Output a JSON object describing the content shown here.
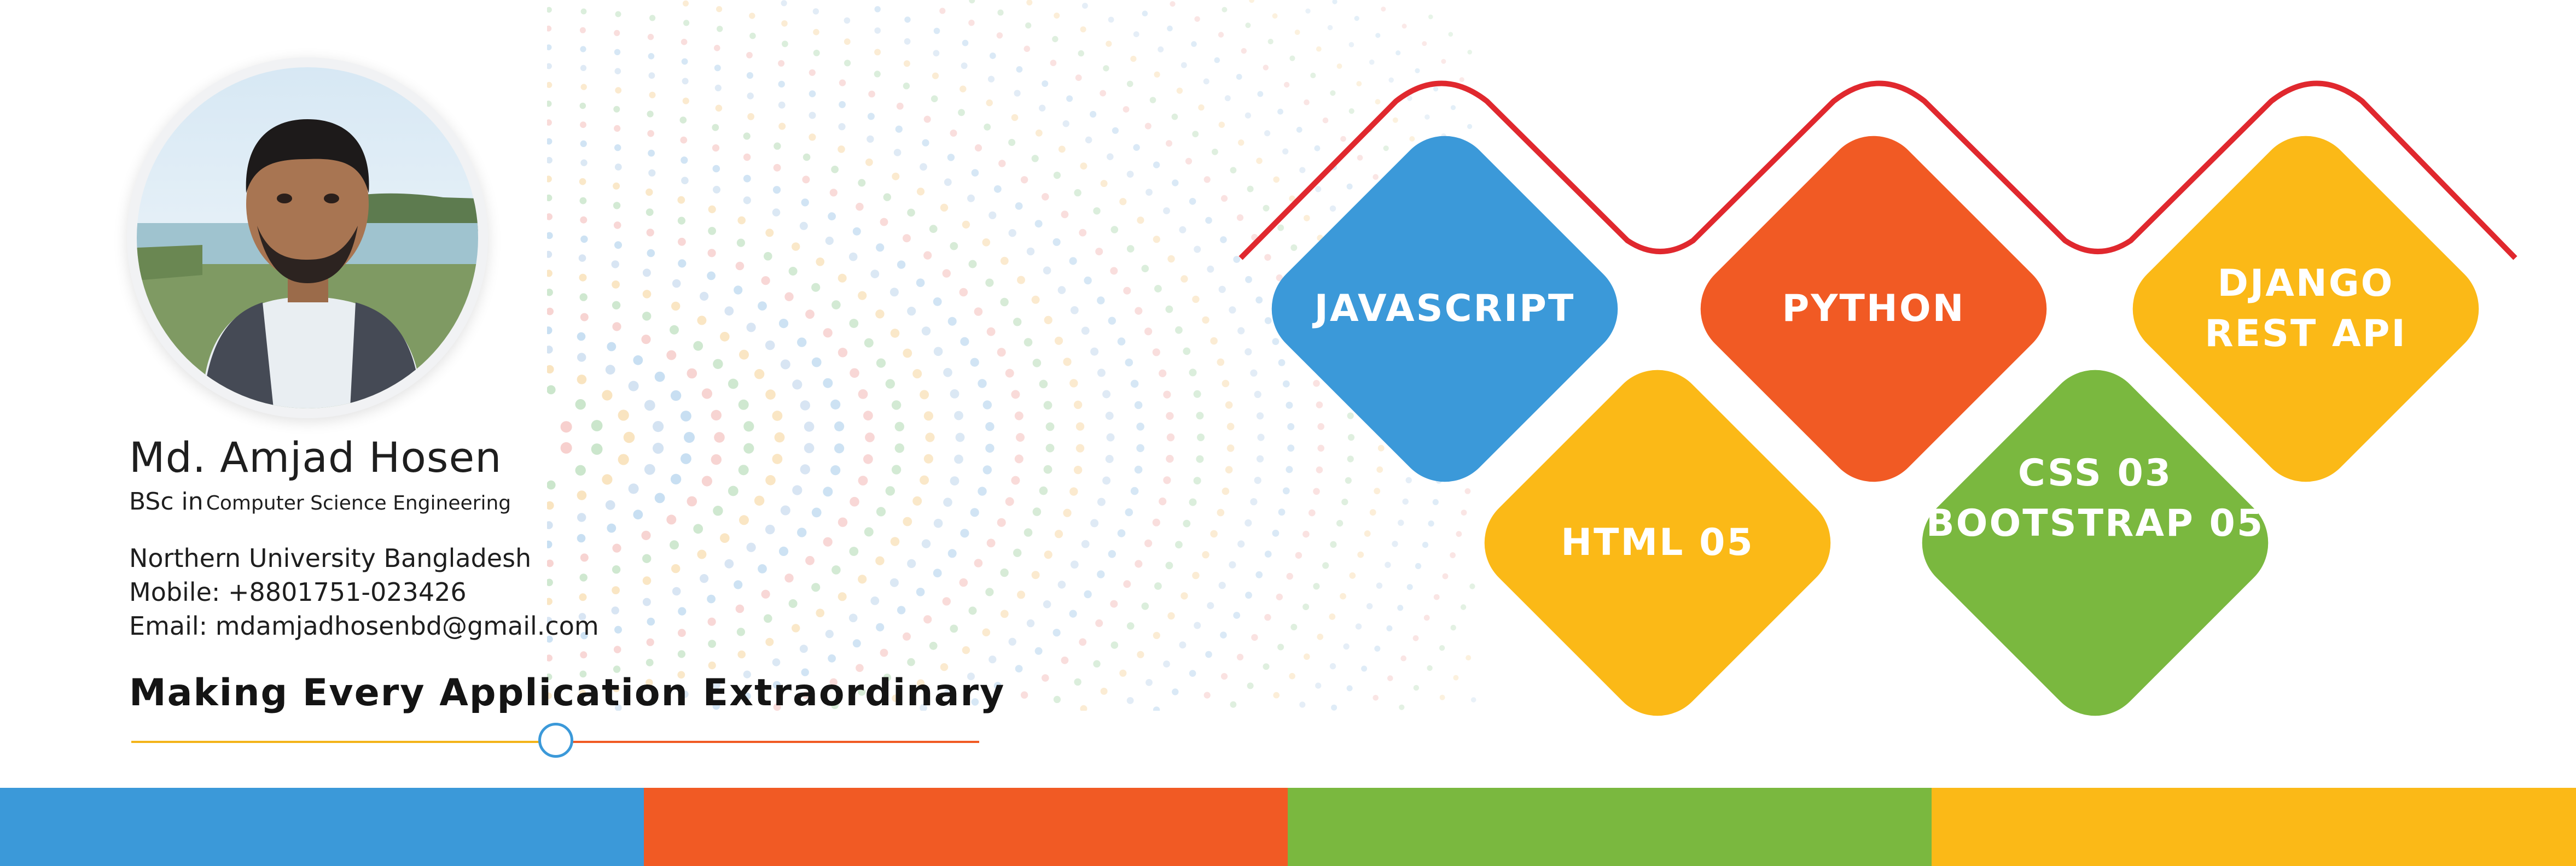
{
  "profile": {
    "name": "Md. Amjad Hosen",
    "degree_prefix": "BSc in",
    "degree_field": "Computer Science Engineering",
    "university": "Northern University Bangladesh",
    "mobile": "Mobile: +8801751-023426",
    "email": "Email: mdamjadhosenbd@gmail.com"
  },
  "tagline": "Making Every Application Extraordinary",
  "skills": [
    {
      "id": "javascript",
      "lines": [
        "JAVASCRIPT"
      ],
      "color": "#3b99d9"
    },
    {
      "id": "python",
      "lines": [
        "PYTHON"
      ],
      "color": "#f15a24"
    },
    {
      "id": "django",
      "lines": [
        "DJANGO",
        "REST API"
      ],
      "color": "#fbb917"
    },
    {
      "id": "html",
      "lines": [
        "HTML 05"
      ],
      "color": "#fbb917"
    },
    {
      "id": "css-bootstrap",
      "lines": [
        "CSS 03",
        "BOOTSTRAP 05"
      ],
      "color": "#7ab83f"
    }
  ],
  "colors": {
    "blue": "#3b99d9",
    "orange": "#f15a24",
    "green": "#7ab83f",
    "yellow": "#fbb917",
    "wave": "#e0282e"
  },
  "stripes": [
    "#3b99d9",
    "#f15a24",
    "#7ab83f",
    "#fbb917"
  ]
}
